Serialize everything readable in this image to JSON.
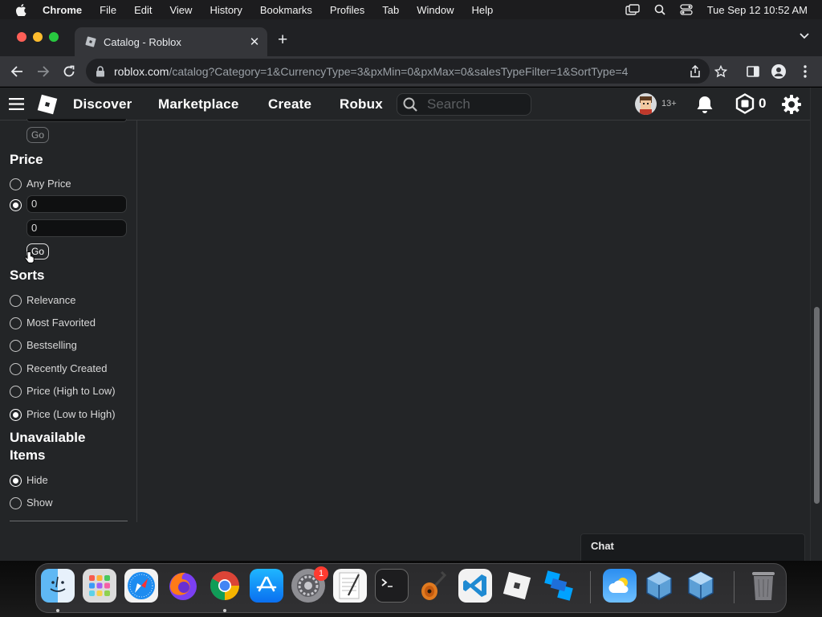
{
  "menubar": {
    "items": [
      "Chrome",
      "File",
      "Edit",
      "View",
      "History",
      "Bookmarks",
      "Profiles",
      "Tab",
      "Window",
      "Help"
    ],
    "clock": "Tue Sep 12  10:52 AM"
  },
  "browser": {
    "tab_title": "Catalog - Roblox",
    "url_domain": "roblox.com",
    "url_path": "/catalog?Category=1&CurrencyType=3&pxMin=0&pxMax=0&salesTypeFilter=1&SortType=4"
  },
  "roblox_header": {
    "nav": [
      "Discover",
      "Marketplace",
      "Create",
      "Robux"
    ],
    "search_placeholder": "Search",
    "age_badge": "13+",
    "robux_balance": "0"
  },
  "sidebar": {
    "go_label": "Go",
    "price": {
      "heading": "Price",
      "any_price": "Any Price",
      "min_value": "0",
      "max_value": "0",
      "selected": "custom"
    },
    "sorts": {
      "heading": "Sorts",
      "options": [
        "Relevance",
        "Most Favorited",
        "Bestselling",
        "Recently Created",
        "Price (High to Low)",
        "Price (Low to High)"
      ],
      "selected": "Price (Low to High)"
    },
    "unavailable": {
      "heading_line1": "Unavailable",
      "heading_line2": "Items",
      "options": [
        "Hide",
        "Show"
      ],
      "selected": "Hide"
    }
  },
  "chat": {
    "label": "Chat"
  },
  "dock": {
    "apps": [
      "finder-icon",
      "launchpad-icon",
      "safari-icon",
      "firefox-icon",
      "chrome-icon",
      "app-store-icon",
      "system-settings-icon",
      "textedit-icon",
      "terminal-icon",
      "garageband-icon",
      "vscode-icon",
      "roblox-icon",
      "roblox-studio-icon",
      "weather-icon",
      "virtualbox-icon",
      "virtualbox-vm-icon",
      "trash-icon"
    ],
    "settings_badge": "1"
  }
}
